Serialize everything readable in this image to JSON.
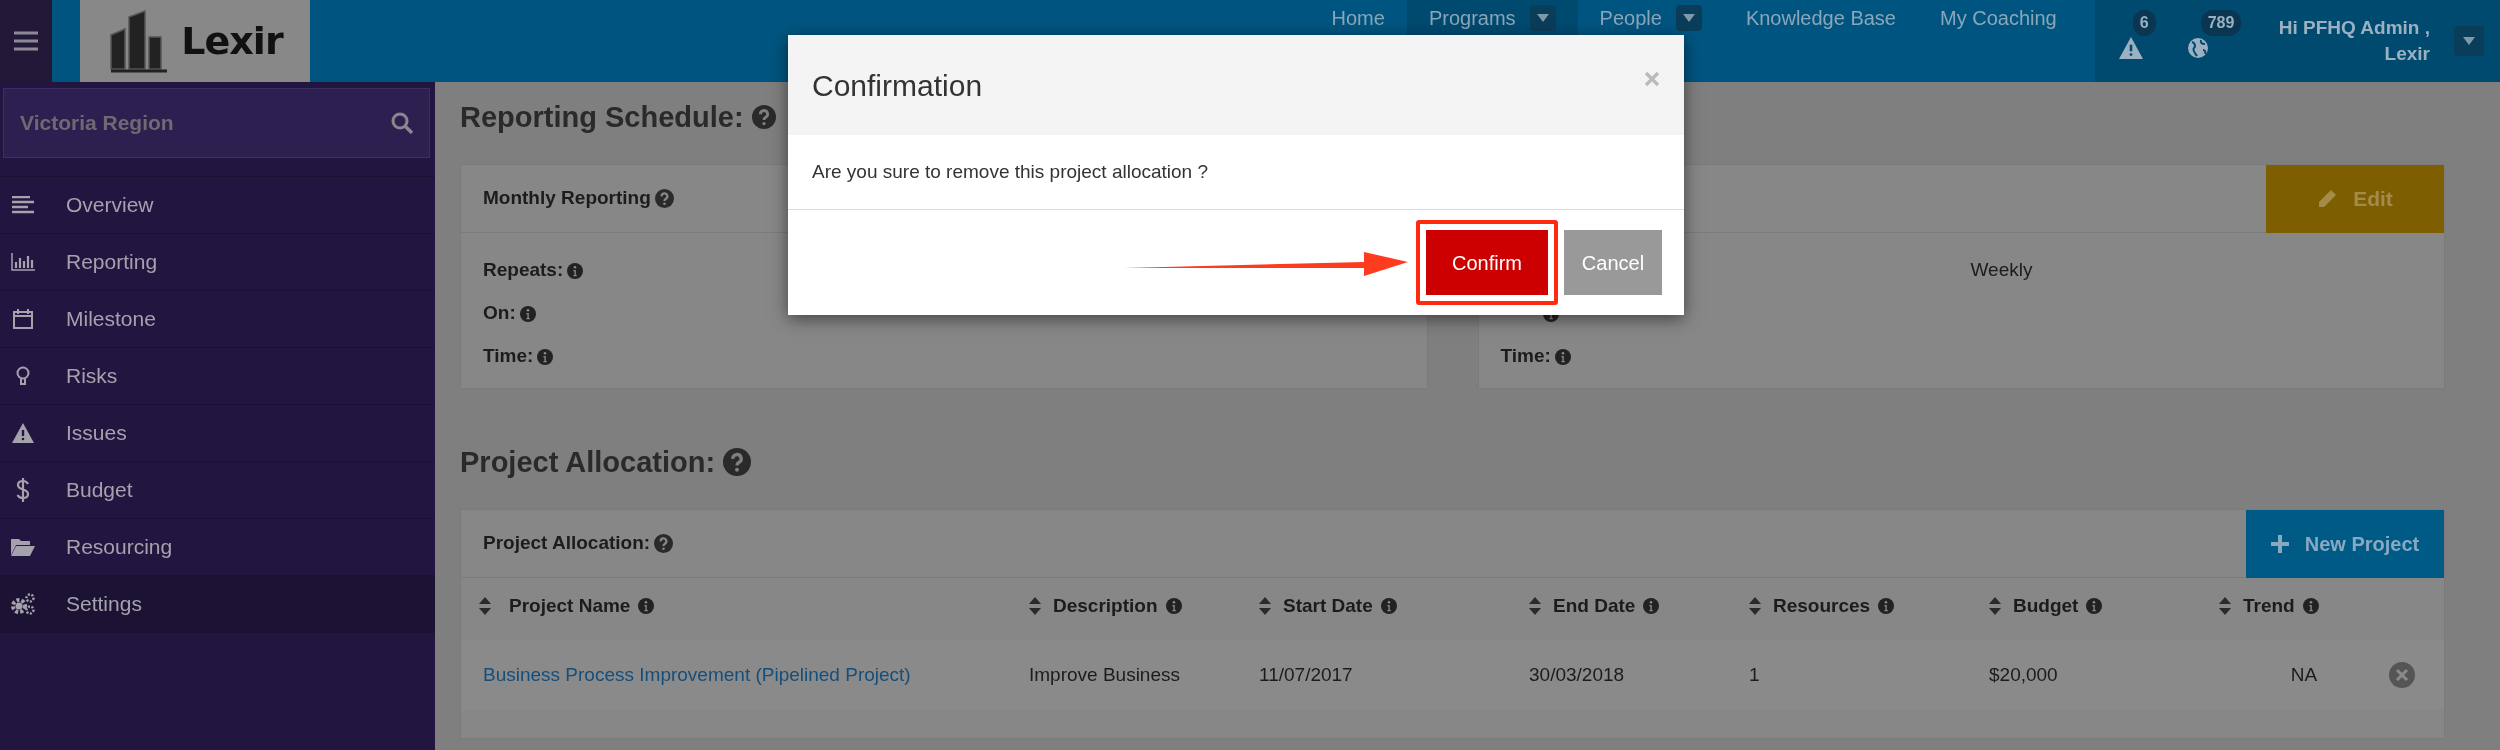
{
  "navbar": {
    "logo_text": "Lexir",
    "items": [
      {
        "label": "Home",
        "selected": false,
        "dropdown": false
      },
      {
        "label": "Programs",
        "selected": true,
        "dropdown": true
      },
      {
        "label": "People",
        "selected": false,
        "dropdown": true
      },
      {
        "label": "Knowledge Base",
        "selected": false,
        "dropdown": false
      },
      {
        "label": "My Coaching",
        "selected": false,
        "dropdown": false
      }
    ],
    "alerts": [
      {
        "kind": "warning",
        "count": "6"
      },
      {
        "kind": "globe",
        "count": "789"
      }
    ],
    "user": {
      "greeting": "Hi PFHQ Admin ,",
      "name": "Lexir"
    }
  },
  "sidebar": {
    "search": {
      "value": "Victoria Region"
    },
    "items": [
      {
        "label": "Overview",
        "kind": "lines",
        "selected": false
      },
      {
        "label": "Reporting",
        "kind": "chart",
        "selected": false
      },
      {
        "label": "Milestone",
        "kind": "calendar",
        "selected": false
      },
      {
        "label": "Risks",
        "kind": "bulb",
        "selected": false
      },
      {
        "label": "Issues",
        "kind": "warning",
        "selected": false
      },
      {
        "label": "Budget",
        "kind": "dollar",
        "selected": false
      },
      {
        "label": "Resourcing",
        "kind": "folder",
        "selected": false
      },
      {
        "label": "Settings",
        "kind": "gears",
        "selected": true
      }
    ]
  },
  "reporting": {
    "title": "Reporting Schedule:",
    "cards": [
      {
        "title": "Monthly Reporting",
        "fields": [
          {
            "label": "Repeats:"
          },
          {
            "label": "On:"
          },
          {
            "label": "Time:"
          }
        ]
      },
      {
        "edit_button": "Edit",
        "fields": [
          {
            "value": "Weekly"
          },
          {
            "kind": "covered"
          },
          {
            "label": "Time:"
          }
        ]
      }
    ]
  },
  "allocation": {
    "title": "Project Allocation:",
    "card_title": "Project Allocation:",
    "new_button": "New Project",
    "columns": [
      "Project Name",
      "Description",
      "Start Date",
      "End Date",
      "Resources",
      "Budget",
      "Trend"
    ],
    "rows": [
      {
        "cells": [
          "Business Process Improvement (Pipelined Project)",
          "Improve Business",
          "11/07/2017",
          "30/03/2018",
          "1",
          "$20,000",
          "NA"
        ]
      }
    ]
  },
  "modal": {
    "title": "Confirmation",
    "message": "Are you sure to remove this project allocation ?",
    "confirm": "Confirm",
    "cancel": "Cancel"
  }
}
